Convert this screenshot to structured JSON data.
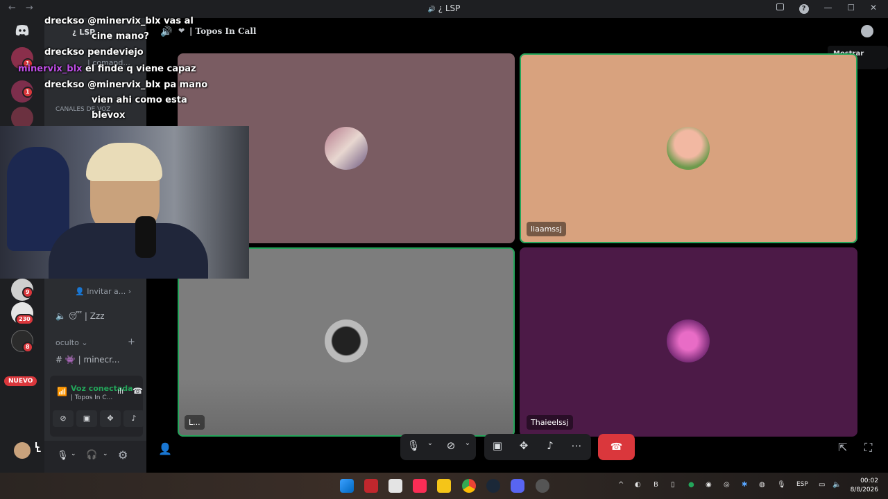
{
  "window": {
    "title": "¿ LSP",
    "title_icon": "🔊",
    "back_icon": "←",
    "forward_icon": "→",
    "inbox_icon": "inbox-icon",
    "help_icon": "?",
    "minimize": "—",
    "maximize": "☐",
    "close": "✕"
  },
  "rail": {
    "badges": [
      "1",
      "1",
      "9",
      "230",
      "8"
    ],
    "nuevo": "NUEVO"
  },
  "sidebar": {
    "server_name": "¿ LSP",
    "command_channel": "| comand...",
    "voice_category": "CANALES DE VOZ",
    "invite": "Invitar a...",
    "zzz_channel": "| Zzz",
    "hidden_category": "oculto",
    "minecraft_channel": "| minecr...",
    "voice_connected": "Voz conectada",
    "voice_channel": "| Topos In C...",
    "username": "L"
  },
  "call": {
    "channel_title": "| Topos In Call",
    "tooltip": "Mostrar chat",
    "tiles": [
      {
        "name": "",
        "bg": "#7a5c62"
      },
      {
        "name": "liaamssj",
        "bg": "#d8a27e"
      },
      {
        "name": "L...",
        "bg": "#7d7d7d"
      },
      {
        "name": "Thaieelssj",
        "bg": "#4c1a47"
      }
    ]
  },
  "chat": {
    "messages": [
      {
        "user": "dreckso",
        "text": "@minervix_blx vas al",
        "cont": "cine mano?"
      },
      {
        "user": "dreckso",
        "text": "pendeviejo",
        "cont": ""
      },
      {
        "user": "minervix_blx",
        "text": "el finde q viene capaz",
        "cont": ""
      },
      {
        "user": "dreckso",
        "text": "@minervix_blx pa mano",
        "cont": "vien ahi como esta"
      },
      {
        "user": "",
        "text": "",
        "cont": "blevox"
      }
    ]
  },
  "taskbar": {
    "lang": "ESP",
    "time": "00:02",
    "date": "8/8/2026"
  }
}
